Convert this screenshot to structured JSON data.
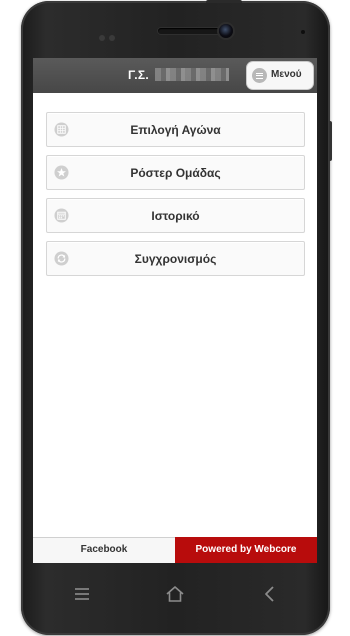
{
  "app": {
    "title": "Γ.Σ.",
    "menu_label": "Μενού"
  },
  "menu_items": [
    {
      "label": "Επιλογή Αγώνα",
      "icon": "grid-icon"
    },
    {
      "label": "Ρόστερ Ομάδας",
      "icon": "star-icon"
    },
    {
      "label": "Ιστορικό",
      "icon": "calendar-icon"
    },
    {
      "label": "Συγχρονισμός",
      "icon": "sync-icon"
    }
  ],
  "footer": {
    "left_label": "Facebook",
    "right_label": "Powered by Webcore"
  },
  "device_nav": {
    "menu_icon": "menu-icon",
    "home_icon": "home-icon",
    "back_icon": "back-icon"
  },
  "colors": {
    "header_bg": "#4f4f4f",
    "footer_accent": "#b80c0c",
    "item_bg": "#fafafa"
  }
}
